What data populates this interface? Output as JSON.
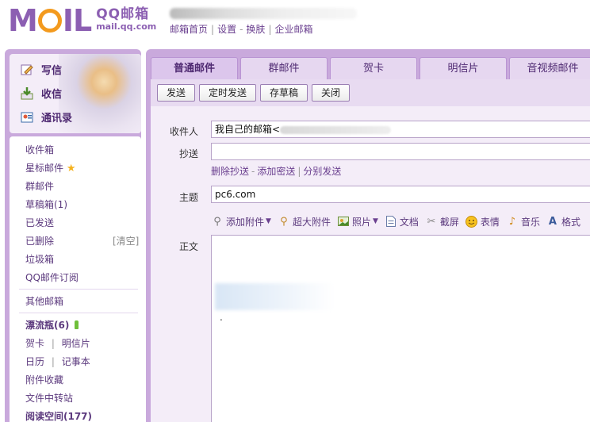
{
  "header": {
    "logo_text": "MAIL",
    "logo_cn": "QQ邮箱",
    "logo_url": "mail.qq.com",
    "links": [
      "邮箱首页",
      "设置",
      "换肤",
      "企业邮箱"
    ],
    "link_sep_dash": "-",
    "link_sep_bar": "|"
  },
  "sidebar": {
    "quick_actions": [
      {
        "label": "写信",
        "icon": "pencil-icon"
      },
      {
        "label": "收信",
        "icon": "inbox-arrow-icon"
      },
      {
        "label": "通讯录",
        "icon": "contacts-icon"
      }
    ],
    "folders": [
      {
        "label": "收件箱"
      },
      {
        "label": "星标邮件",
        "icon": "star-icon"
      },
      {
        "label": "群邮件"
      },
      {
        "label": "草稿箱(1)"
      },
      {
        "label": "已发送"
      },
      {
        "label": "已删除",
        "extra": "[清空]"
      },
      {
        "label": "垃圾箱"
      },
      {
        "label": "QQ邮件订阅"
      }
    ],
    "other_mailbox": "其他邮箱",
    "drift_bottle": "漂流瓶(6)",
    "greeting_card": "贺卡",
    "postcard": "明信片",
    "calendar": "日历",
    "notepad": "记事本",
    "attachment_fav": "附件收藏",
    "file_transfer": "文件中转站",
    "reading_space": "阅读空间(177)",
    "sep": "|"
  },
  "compose": {
    "tabs": [
      "普通邮件",
      "群邮件",
      "贺卡",
      "明信片",
      "音视频邮件"
    ],
    "active_tab": 0,
    "buttons": [
      "发送",
      "定时发送",
      "存草稿",
      "关闭"
    ],
    "to_label": "收件人",
    "to_value": "我自己的邮箱<",
    "cc_label": "抄送",
    "cc_value": "",
    "cc_links": [
      "删除抄送",
      "添加密送",
      "分别发送"
    ],
    "cc_link_sep_dash": "-",
    "cc_link_sep_bar": "|",
    "subject_label": "主题",
    "subject_value": "pc6.com",
    "attach_tools": [
      {
        "label": "添加附件",
        "icon": "paperclip-icon",
        "dropdown": true
      },
      {
        "label": "超大附件",
        "icon": "large-attachment-icon",
        "dropdown": false
      },
      {
        "label": "照片",
        "icon": "photo-icon",
        "dropdown": true
      },
      {
        "label": "文档",
        "icon": "document-icon",
        "dropdown": false
      },
      {
        "label": "截屏",
        "icon": "screenshot-icon",
        "dropdown": false
      },
      {
        "label": "表情",
        "icon": "smiley-icon",
        "dropdown": false
      },
      {
        "label": "音乐",
        "icon": "music-icon",
        "dropdown": false
      },
      {
        "label": "格式",
        "icon": "font-format-icon",
        "dropdown": false
      }
    ],
    "body_label": "正文",
    "body_signature_line": "------------------",
    "body_dot": "."
  },
  "colors": {
    "brand_purple": "#8c5fb2",
    "panel_purple": "#c9a9dc",
    "logo_orange": "#f39a1e",
    "link_purple": "#6a3f8f"
  }
}
